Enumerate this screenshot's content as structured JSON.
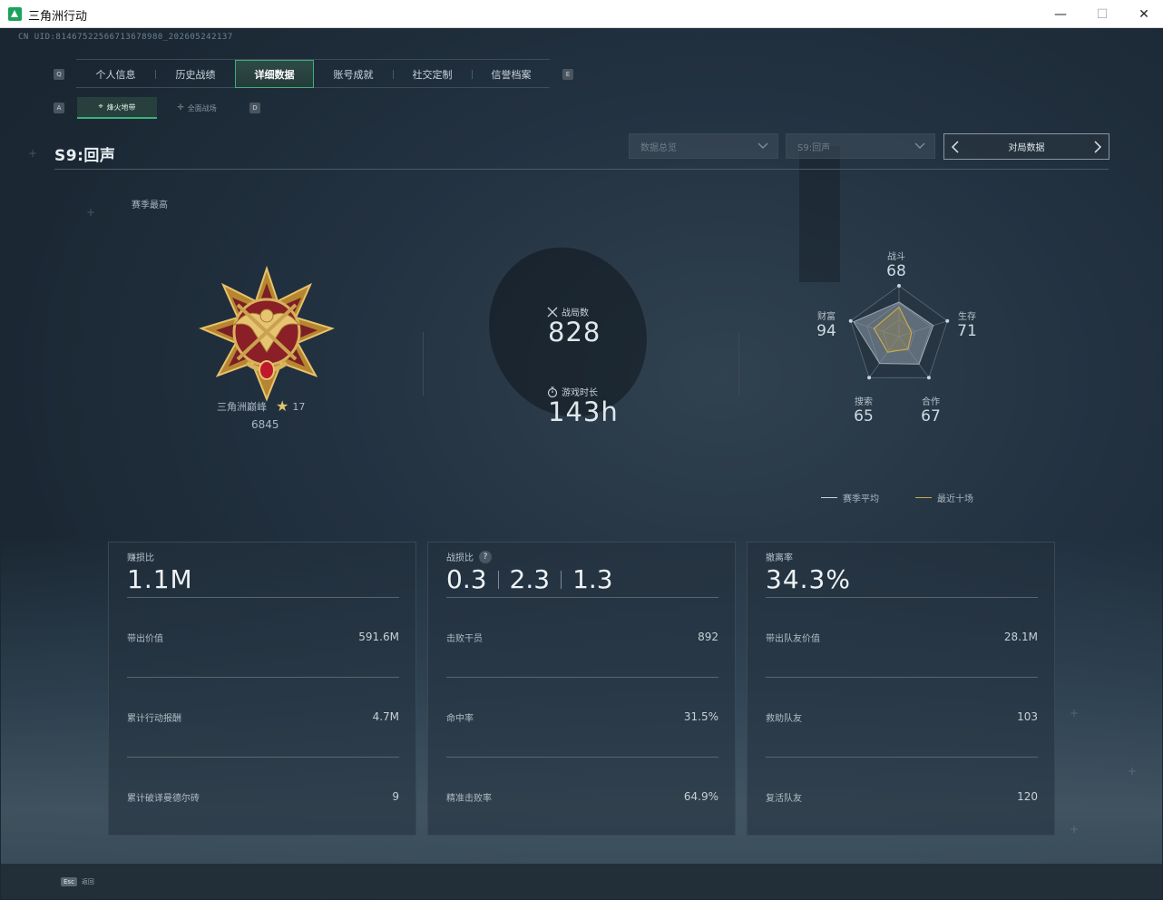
{
  "window": {
    "title": "三角洲行动",
    "minimize": "—",
    "maximize": "☐",
    "close": "✕"
  },
  "uid": "CN UID:8146752256671367898​0_202605242137",
  "nav": {
    "key_left": "Q",
    "key_right": "E",
    "tabs": [
      {
        "label": "个人信息",
        "active": false
      },
      {
        "label": "历史战绩",
        "active": false
      },
      {
        "label": "详细数据",
        "active": true
      },
      {
        "label": "账号成就",
        "active": false
      },
      {
        "label": "社交定制",
        "active": false
      },
      {
        "label": "信誉档案",
        "active": false
      }
    ]
  },
  "subnav": {
    "key_left": "A",
    "key_right": "D",
    "tabs": [
      {
        "label": "烽火地带",
        "icon": "compass-icon",
        "active": true
      },
      {
        "label": "全面战场",
        "icon": "crosshair-icon",
        "active": false
      }
    ]
  },
  "header": {
    "season_title": "S9:回声",
    "dropdown_1": "数据总览",
    "dropdown_2": "S9:回声",
    "nav_label": "对局数据"
  },
  "rank": {
    "section_label": "赛季最高",
    "name": "三角洲巅峰",
    "stars": "17",
    "score": "6845"
  },
  "stats": {
    "matches_label": "战局数",
    "matches_value": "828",
    "playtime_label": "游戏时长",
    "playtime_value": "143h"
  },
  "radar": {
    "axes": [
      {
        "label": "战斗",
        "value": "68"
      },
      {
        "label": "生存",
        "value": "71"
      },
      {
        "label": "合作",
        "value": "67"
      },
      {
        "label": "搜索",
        "value": "65"
      },
      {
        "label": "财富",
        "value": "94"
      }
    ],
    "season_avg_values": [
      68,
      71,
      67,
      65,
      94
    ],
    "recent_ten_values": [
      58,
      26,
      30,
      38,
      52
    ],
    "legend_season": "赛季平均",
    "legend_recent": "最近十场",
    "color_season": "#9aa8b4",
    "color_recent": "#c9a94e"
  },
  "panels": [
    {
      "label": "赚损比",
      "big": "1.1M",
      "rows": [
        {
          "label": "带出价值",
          "value": "591.6M"
        },
        {
          "label": "累计行动报酬",
          "value": "4.7M"
        },
        {
          "label": "累计破译曼德尔砖",
          "value": "9"
        }
      ]
    },
    {
      "label": "战损比",
      "help": "?",
      "kd_values": [
        "0.3",
        "2.3",
        "1.3"
      ],
      "rows": [
        {
          "label": "击败干员",
          "value": "892"
        },
        {
          "label": "命中率",
          "value": "31.5%"
        },
        {
          "label": "精准击败率",
          "value": "64.9%"
        }
      ]
    },
    {
      "label": "撤离率",
      "big": "34.3%",
      "rows": [
        {
          "label": "带出队友价值",
          "value": "28.1M"
        },
        {
          "label": "救助队友",
          "value": "103"
        },
        {
          "label": "复活队友",
          "value": "120"
        }
      ]
    }
  ],
  "footer": {
    "key": "Esc",
    "label": "返回"
  }
}
